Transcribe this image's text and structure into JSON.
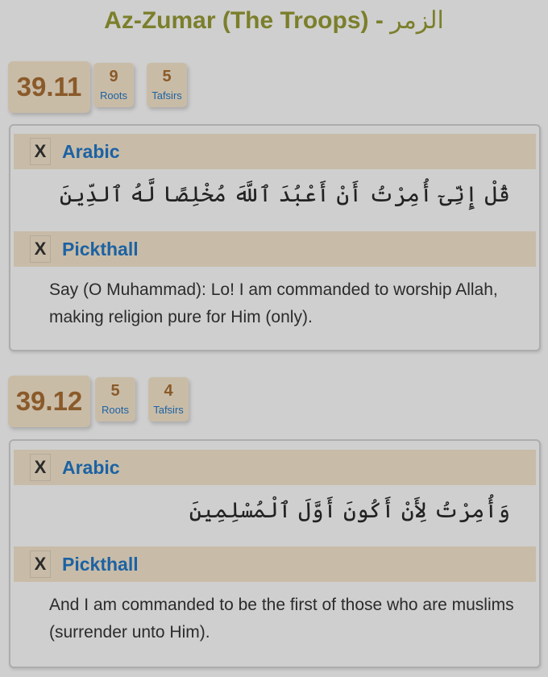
{
  "page": {
    "title_en": "Az-Zumar (The Troops) -",
    "title_ar": "الزمر"
  },
  "verses": [
    {
      "ref": "39.11",
      "roots": {
        "count": "9",
        "label": "Roots"
      },
      "tafsirs": {
        "count": "5",
        "label": "Tafsirs"
      },
      "sections": [
        {
          "close": "X",
          "label": "Arabic",
          "text": "قُلْ إِنِّىٓ أُمِرْتُ أَنْ أَعْبُدَ ٱللَّهَ مُخْلِصًا لَّهُ ٱلدِّينَ"
        },
        {
          "close": "X",
          "label": "Pickthall",
          "text": "Say (O Muhammad): Lo! I am commanded to worship Allah, making religion pure for Him (only)."
        }
      ]
    },
    {
      "ref": "39.12",
      "roots": {
        "count": "5",
        "label": "Roots"
      },
      "tafsirs": {
        "count": "4",
        "label": "Tafsirs"
      },
      "sections": [
        {
          "close": "X",
          "label": "Arabic",
          "text": "وَأُمِرْتُ لِأَنْ أَكُونَ أَوَّلَ ٱلْمُسْلِمِينَ"
        },
        {
          "close": "X",
          "label": "Pickthall",
          "text": "And I am commanded to be the first of those who are muslims (surrender unto Him)."
        }
      ]
    }
  ],
  "colors": {
    "background": "#cfcfcf",
    "title": "#7b7f2b",
    "ref_number": "#8a5a2a",
    "link_blue": "#1c62a3",
    "section_bar": "#c8bca8"
  }
}
